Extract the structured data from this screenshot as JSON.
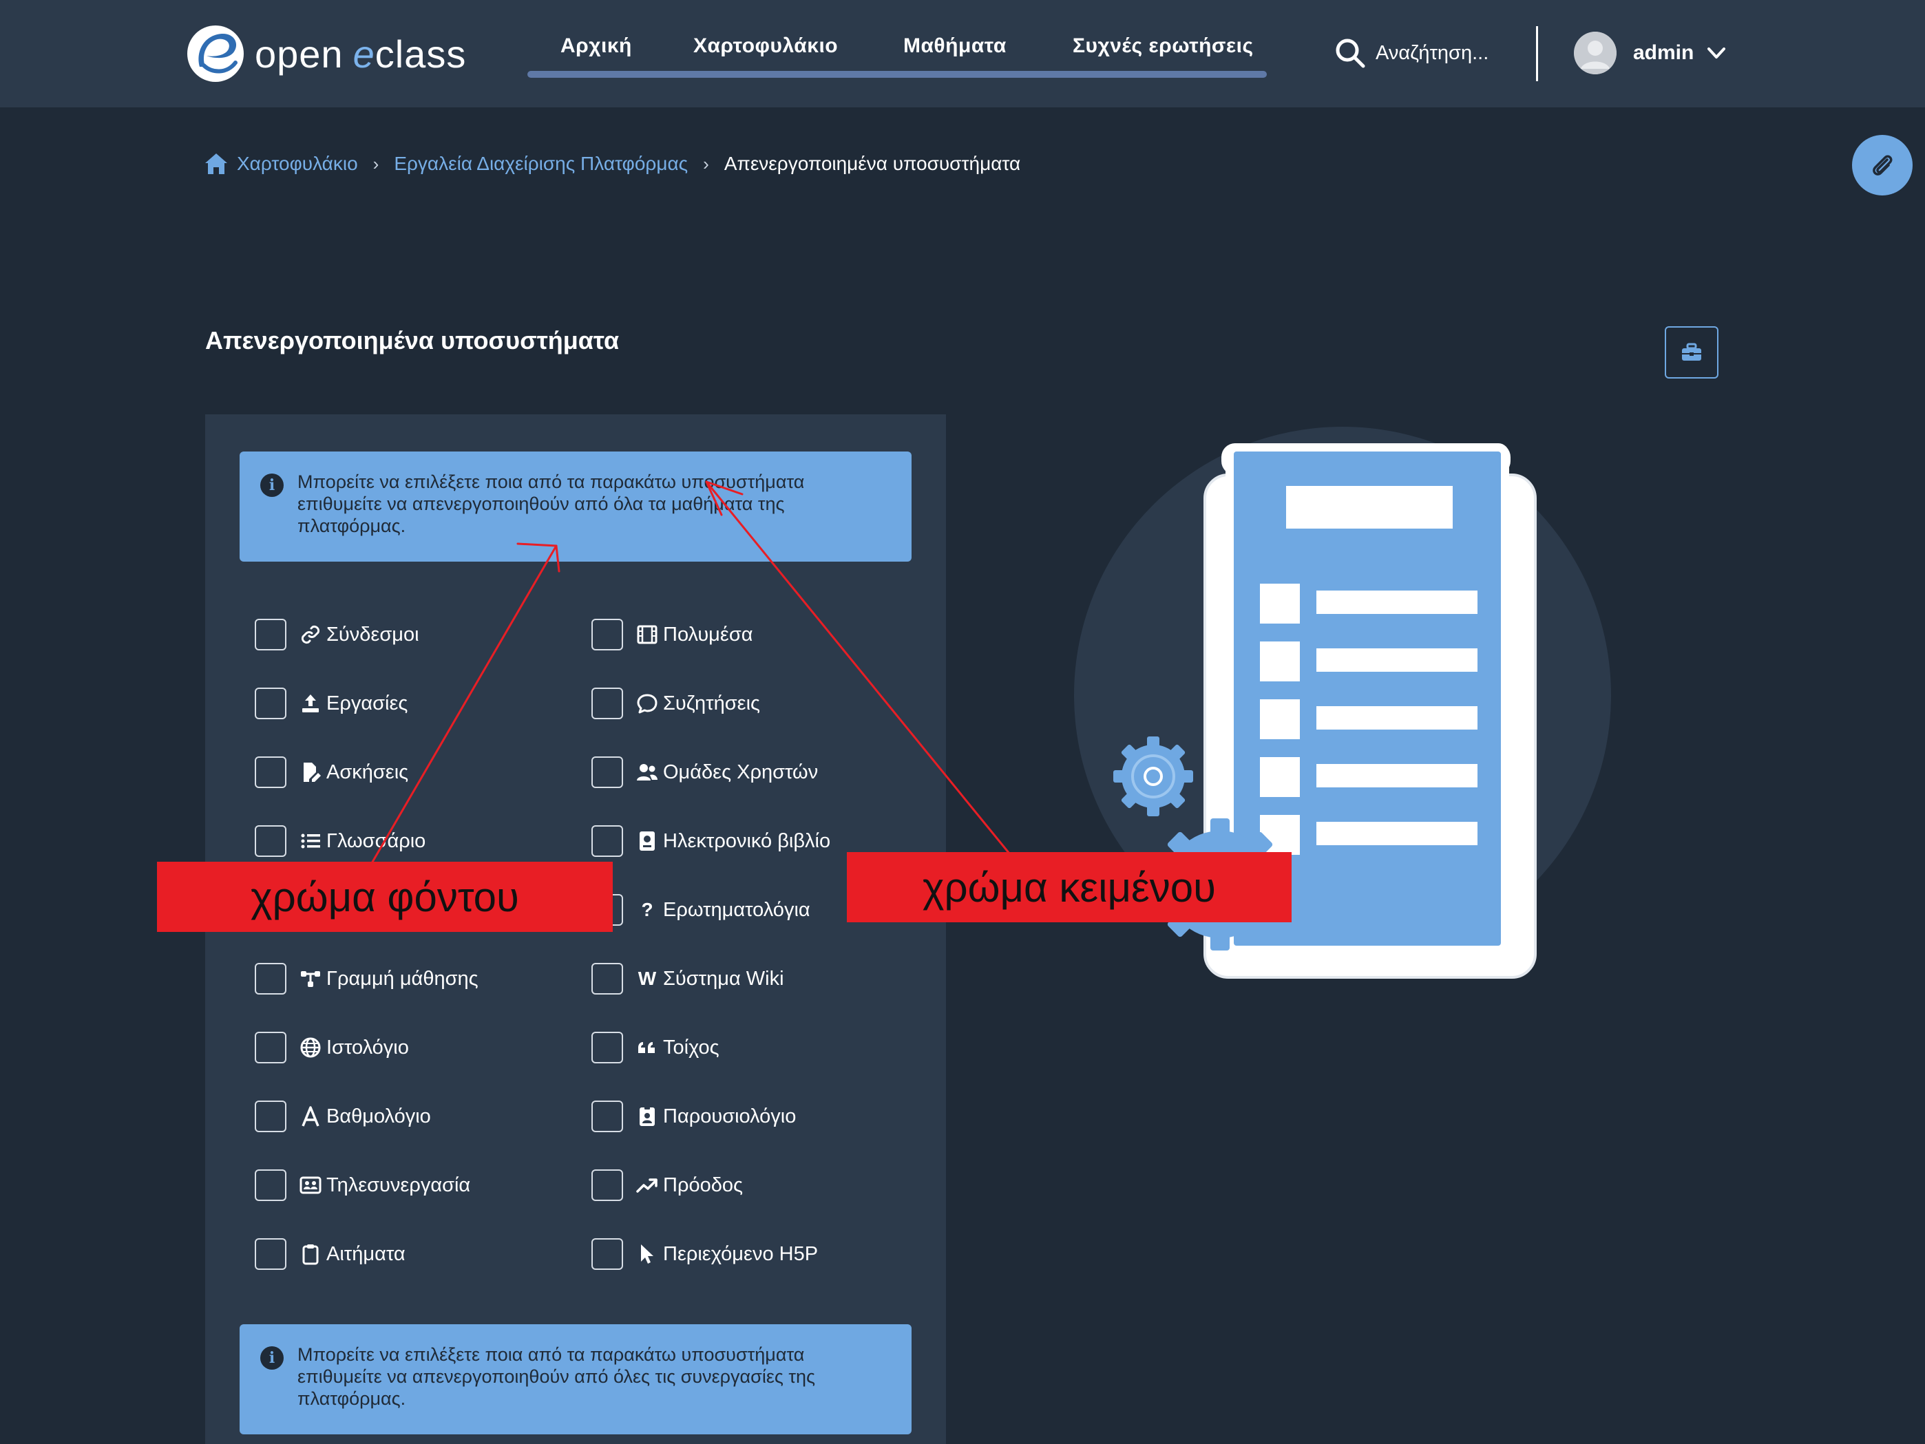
{
  "header": {
    "logo": {
      "open": "open",
      "e": "e",
      "class": "class"
    },
    "nav": [
      {
        "label": "Αρχική"
      },
      {
        "label": "Χαρτοφυλάκιο"
      },
      {
        "label": "Μαθήματα"
      },
      {
        "label": "Συχνές ερωτήσεις"
      }
    ],
    "search_placeholder": "Αναζήτηση...",
    "user_name": "admin"
  },
  "breadcrumb": {
    "home": "Χαρτοφυλάκιο",
    "admin": "Εργαλεία Διαχείρισης Πλατφόρμας",
    "current": "Απενεργοποιημένα υποσυστήματα"
  },
  "page_title": "Απενεργοποιημένα υποσυστήματα",
  "alert_courses": "Μπορείτε να επιλέξετε ποια από τα παρακάτω υποσυστήματα επιθυμείτε να απενεργοποιηθούν από όλα τα μαθήματα της πλατφόρμας.",
  "alert_collab": "Μπορείτε να επιλέξετε ποια από τα παρακάτω υποσυστήματα επιθυμείτε να απενεργοποιηθούν από όλες τις συνεργασίες της πλατφόρμας.",
  "modules_left": [
    {
      "label": "Σύνδεσμοι",
      "icon": "link-icon",
      "checked": false
    },
    {
      "label": "Εργασίες",
      "icon": "upload-icon",
      "checked": false
    },
    {
      "label": "Ασκήσεις",
      "icon": "file-pen-icon",
      "checked": false
    },
    {
      "label": "Γλωσσάριο",
      "icon": "list-icon",
      "checked": false
    },
    {
      "label": "",
      "icon": "",
      "checked": false
    },
    {
      "label": "Γραμμή μάθησης",
      "icon": "path-icon",
      "checked": false
    },
    {
      "label": "Ιστολόγιο",
      "icon": "globe-icon",
      "checked": false
    },
    {
      "label": "Βαθμολόγιο",
      "icon": "grade-a-icon",
      "checked": false
    },
    {
      "label": "Τηλεσυνεργασία",
      "icon": "conference-icon",
      "checked": false
    },
    {
      "label": "Αιτήματα",
      "icon": "clipboard-icon",
      "checked": false
    }
  ],
  "modules_right": [
    {
      "label": "Πολυμέσα",
      "icon": "film-icon",
      "checked": false
    },
    {
      "label": "Συζητήσεις",
      "icon": "comment-icon",
      "checked": false
    },
    {
      "label": "Ομάδες Χρηστών",
      "icon": "users-icon",
      "checked": false
    },
    {
      "label": "Ηλεκτρονικό βιβλίο",
      "icon": "ebook-icon",
      "checked": false
    },
    {
      "label": "Ερωτηματολόγια",
      "icon": "question-icon",
      "checked": false
    },
    {
      "label": "Σύστημα Wiki",
      "icon": "wiki-icon",
      "checked": false
    },
    {
      "label": "Τοίχος",
      "icon": "quote-icon",
      "checked": false
    },
    {
      "label": "Παρουσιολόγιο",
      "icon": "id-badge-icon",
      "checked": false
    },
    {
      "label": "Πρόοδος",
      "icon": "trend-up-icon",
      "checked": false
    },
    {
      "label": "Περιεχόμενο H5P",
      "icon": "pointer-icon",
      "checked": false
    }
  ],
  "annotations": {
    "background_color_label": "χρώμα φόντου",
    "text_color_label": "χρώμα κειμένου"
  },
  "colors": {
    "page_bg": "#1f2a37",
    "header_bg": "#2c3a4b",
    "panel_bg": "#2c3a4b",
    "accent": "#6fa8e2",
    "link": "#77aee6",
    "annotation_red": "#e81e25"
  }
}
